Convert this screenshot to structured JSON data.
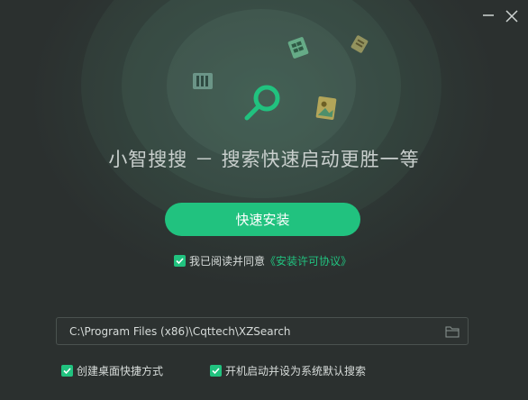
{
  "app": {
    "slogan": "小智搜搜 － 搜索快速启动更胜一等"
  },
  "titlebar": {
    "minimize_icon": "minimize-icon",
    "close_icon": "close-icon"
  },
  "install": {
    "button_label": "快速安装"
  },
  "agreement": {
    "checked": true,
    "text": "我已阅读并同意",
    "link_text": "《安装许可协议》"
  },
  "install_path": {
    "value": "C:\\Program Files (x86)\\Cqttech\\XZSearch",
    "browse_icon": "folder-icon"
  },
  "options": [
    {
      "label": "创建桌面快捷方式",
      "checked": true
    },
    {
      "label": "开机启动并设为系统默认搜索",
      "checked": true
    }
  ],
  "colors": {
    "accent": "#21c27f",
    "background": "#2b302f"
  }
}
